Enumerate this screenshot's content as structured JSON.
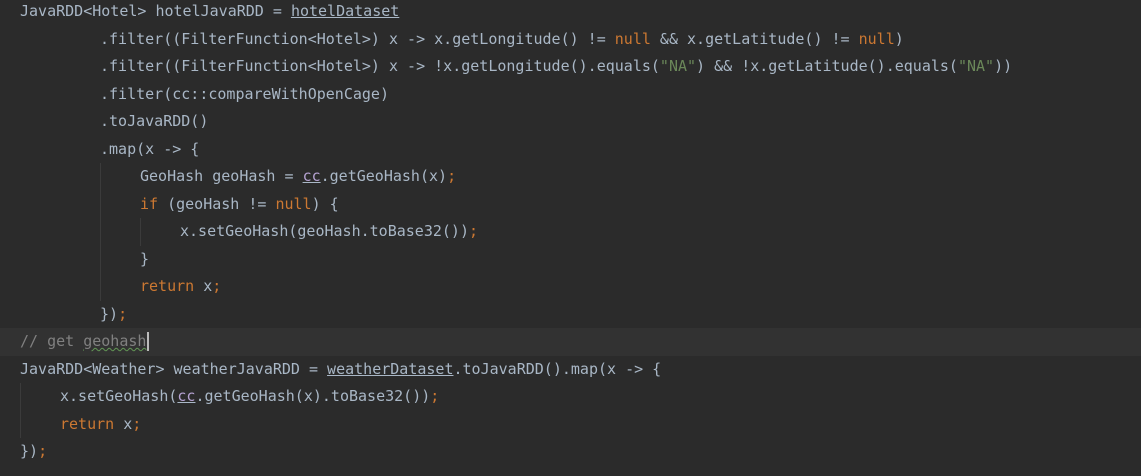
{
  "editor": {
    "lines": [
      {
        "segments": [
          {
            "t": "JavaRDD<Hotel> hotelJavaRDD = "
          },
          {
            "t": "hotelDataset",
            "c": "ul"
          }
        ]
      },
      {
        "segments": [
          {
            "t": ".filter((FilterFunction<Hotel>) x -> x.getLongitude() != "
          },
          {
            "t": "null",
            "c": "kw"
          },
          {
            "t": " && x.getLatitude() != "
          },
          {
            "t": "null",
            "c": "kw"
          },
          {
            "t": ")"
          }
        ]
      },
      {
        "segments": [
          {
            "t": ".filter((FilterFunction<Hotel>) x -> !x.getLongitude().equals("
          },
          {
            "t": "\"NA\"",
            "c": "str"
          },
          {
            "t": ") && !x.getLatitude().equals("
          },
          {
            "t": "\"NA\"",
            "c": "str"
          },
          {
            "t": "))"
          }
        ]
      },
      {
        "segments": [
          {
            "t": ".filter(cc::compareWithOpenCage)"
          }
        ]
      },
      {
        "segments": [
          {
            "t": ".toJavaRDD()"
          }
        ]
      },
      {
        "segments": [
          {
            "t": ".map(x -> {"
          }
        ]
      },
      {
        "segments": [
          {
            "t": "GeoHash geoHash = "
          },
          {
            "t": "cc",
            "c": "ulp"
          },
          {
            "t": ".getGeoHash(x)"
          },
          {
            "t": ";",
            "c": "kw"
          }
        ]
      },
      {
        "segments": [
          {
            "t": "if",
            "c": "kw"
          },
          {
            "t": " (geoHash != "
          },
          {
            "t": "null",
            "c": "kw"
          },
          {
            "t": ") {"
          }
        ]
      },
      {
        "segments": [
          {
            "t": "x.setGeoHash(geoHash.toBase32())"
          },
          {
            "t": ";",
            "c": "kw"
          }
        ]
      },
      {
        "segments": [
          {
            "t": "}"
          }
        ]
      },
      {
        "segments": [
          {
            "t": "return",
            "c": "kw"
          },
          {
            "t": " x"
          },
          {
            "t": ";",
            "c": "kw"
          }
        ]
      },
      {
        "segments": [
          {
            "t": "})"
          },
          {
            "t": ";",
            "c": "kw"
          }
        ]
      },
      {
        "segments": [
          {
            "t": "// get ",
            "c": "cmt"
          },
          {
            "t": "geohash",
            "c": "cmt sq"
          }
        ]
      },
      {
        "segments": [
          {
            "t": "JavaRDD<Weather> weatherJavaRDD = "
          },
          {
            "t": "weatherDataset",
            "c": "ul"
          },
          {
            "t": ".toJavaRDD().map(x -> {"
          }
        ]
      },
      {
        "segments": [
          {
            "t": "x.setGeoHash("
          },
          {
            "t": "cc",
            "c": "ulp"
          },
          {
            "t": ".getGeoHash(x).toBase32())"
          },
          {
            "t": ";",
            "c": "kw"
          }
        ]
      },
      {
        "segments": [
          {
            "t": "return",
            "c": "kw"
          },
          {
            "t": " x"
          },
          {
            "t": ";",
            "c": "kw"
          }
        ]
      },
      {
        "segments": [
          {
            "t": "})"
          },
          {
            "t": ";",
            "c": "kw"
          }
        ]
      }
    ]
  },
  "colors": {
    "background": "#2b2b2b",
    "current_line": "#323232",
    "default_text": "#a9b7c6",
    "keyword": "#cc7832",
    "string": "#6a8759",
    "comment": "#808080",
    "field": "#b5a2d1"
  }
}
